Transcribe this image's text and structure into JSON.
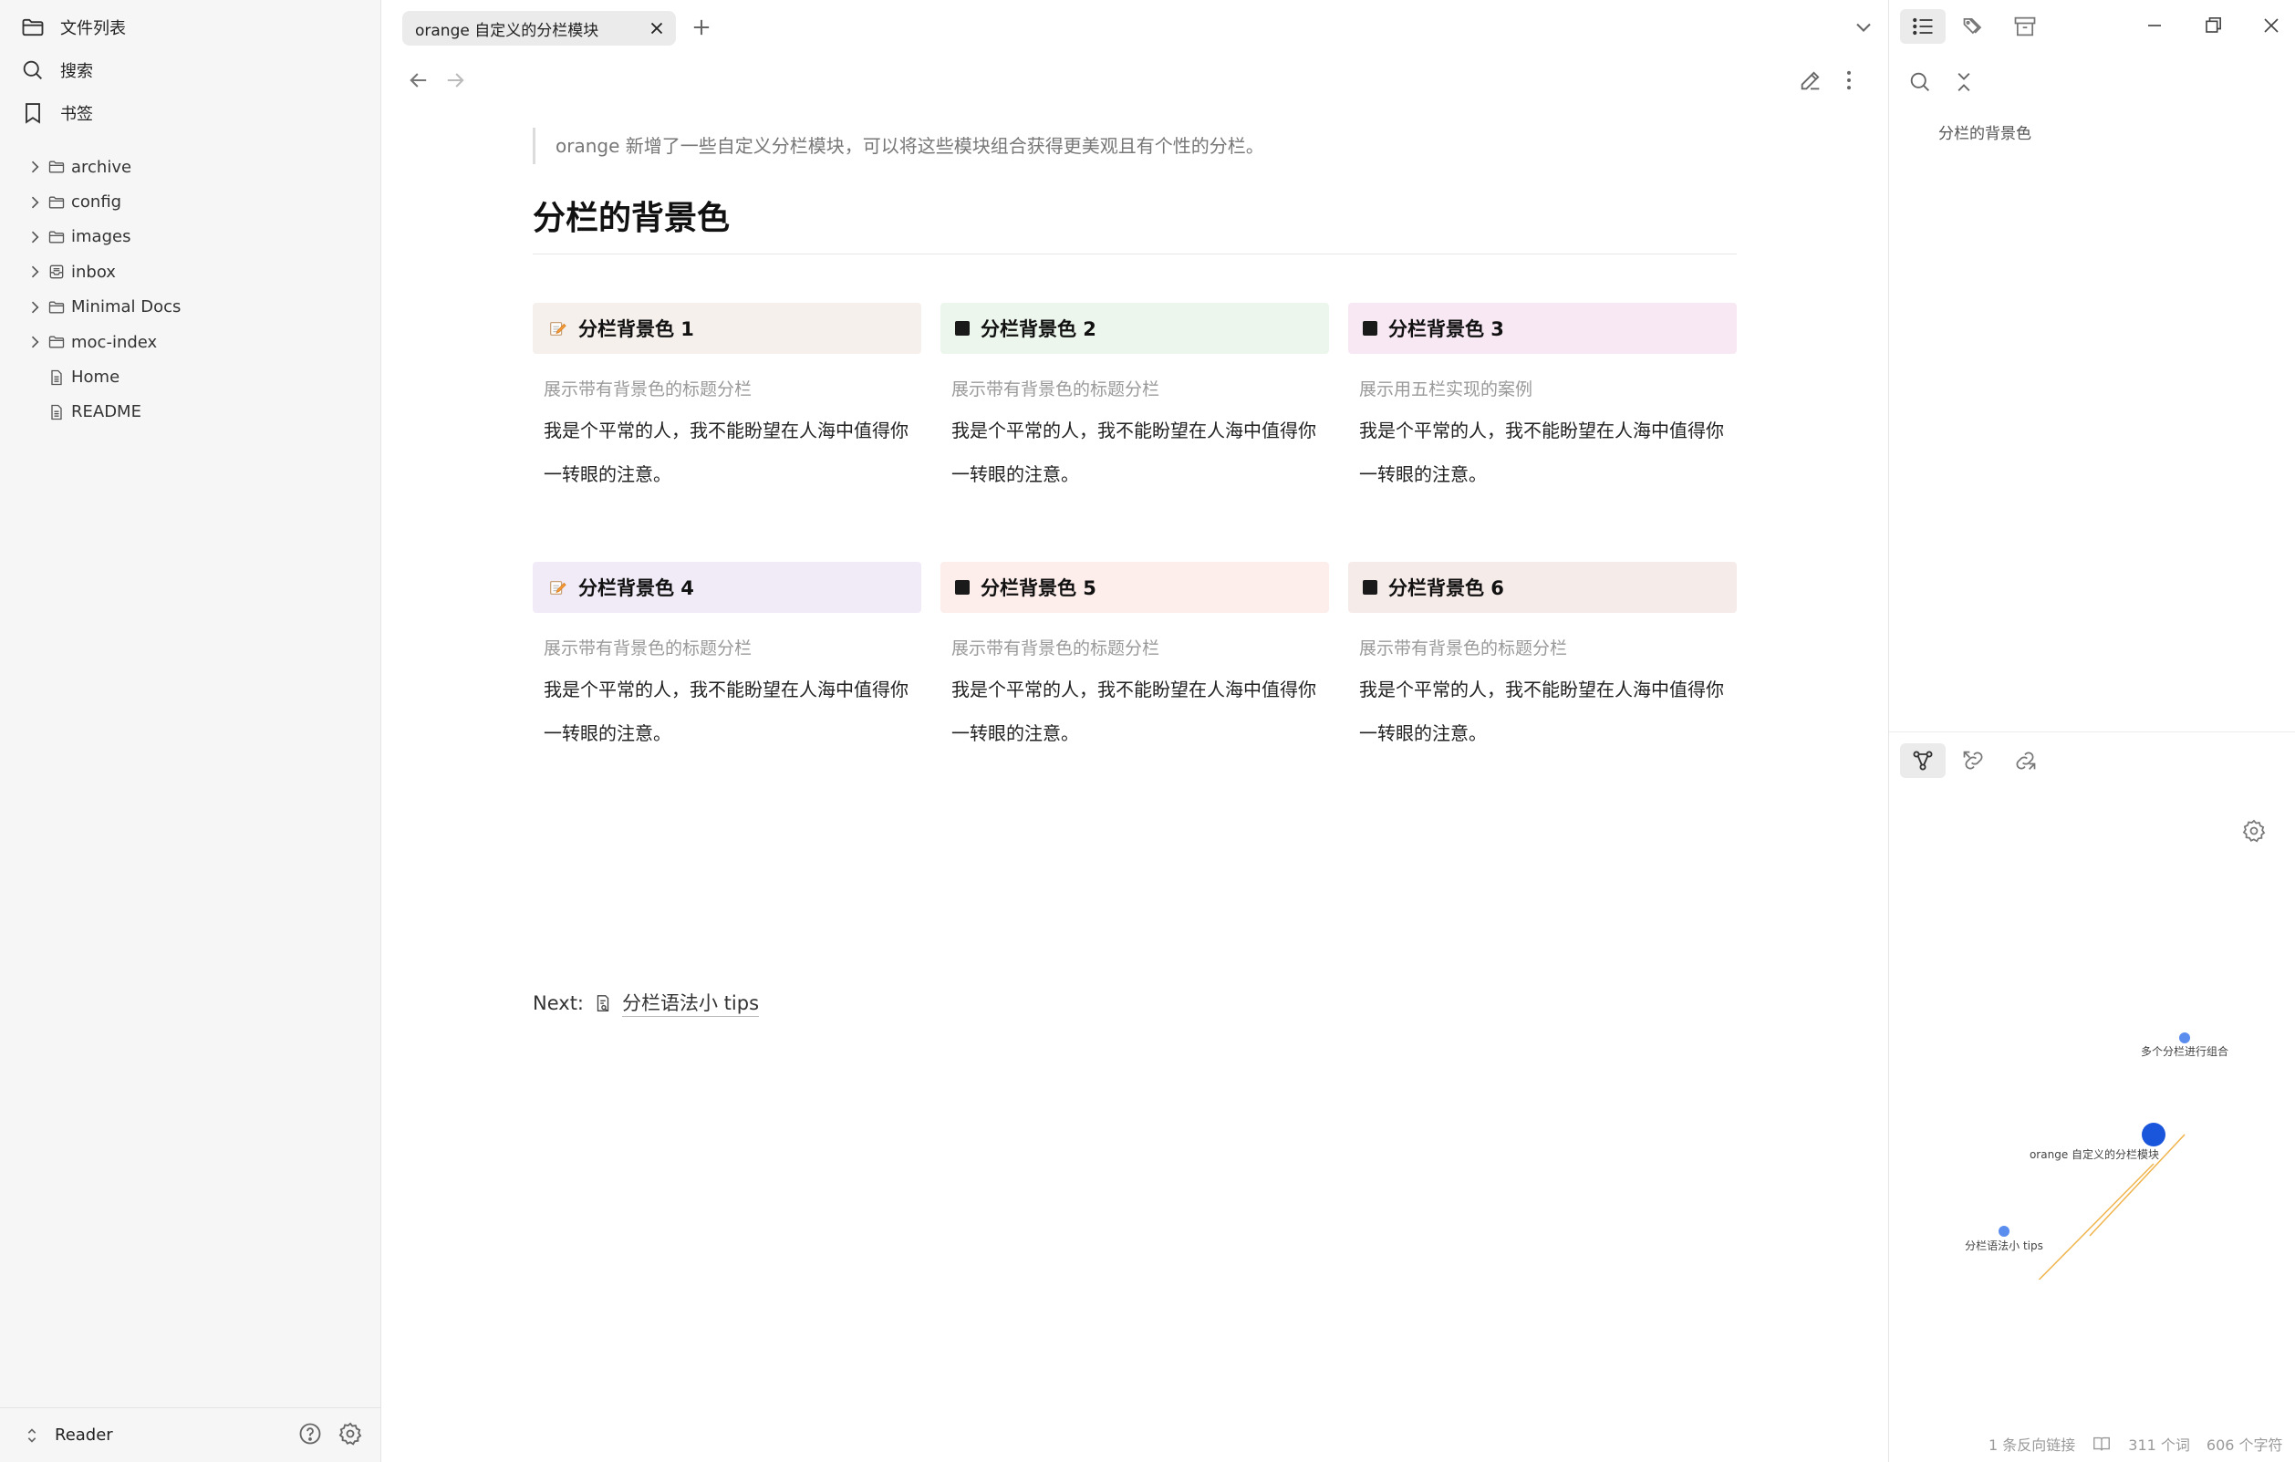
{
  "sidebar": {
    "nav": {
      "files_label": "文件列表",
      "search_label": "搜索",
      "bookmarks_label": "书签"
    },
    "tree": [
      {
        "label": "archive",
        "kind": "folder",
        "expandable": true
      },
      {
        "label": "config",
        "kind": "folder",
        "expandable": true
      },
      {
        "label": "images",
        "kind": "folder",
        "expandable": true
      },
      {
        "label": "inbox",
        "kind": "inbox",
        "expandable": true
      },
      {
        "label": "Minimal Docs",
        "kind": "folder",
        "expandable": true
      },
      {
        "label": "moc-index",
        "kind": "folder",
        "expandable": true
      },
      {
        "label": "Home",
        "kind": "file",
        "expandable": false
      },
      {
        "label": "README",
        "kind": "file",
        "expandable": false
      }
    ],
    "footer": {
      "vault_name": "Reader"
    }
  },
  "tabs": {
    "active_title": "orange 自定义的分栏模块"
  },
  "note": {
    "quote": "orange 新增了一些自定义分栏模块，可以将这些模块组合获得更美观且有个性的分栏。",
    "heading": "分栏的背景色",
    "cards": [
      {
        "title": "分栏背景色 1",
        "icon": "pencil",
        "bg": "#f5f0eb",
        "sub": "展示带有背景色的标题分栏",
        "body": "我是个平常的人，我不能盼望在人海中值得你一转眼的注意。"
      },
      {
        "title": "分栏背景色 2",
        "icon": "square",
        "bg": "#edf6ed",
        "sub": "展示带有背景色的标题分栏",
        "body": "我是个平常的人，我不能盼望在人海中值得你一转眼的注意。"
      },
      {
        "title": "分栏背景色 3",
        "icon": "square",
        "bg": "#f7e8f4",
        "sub": "展示用五栏实现的案例",
        "body": "我是个平常的人，我不能盼望在人海中值得你一转眼的注意。"
      },
      {
        "title": "分栏背景色 4",
        "icon": "pencil",
        "bg": "#f1ebf7",
        "sub": "展示带有背景色的标题分栏",
        "body": "我是个平常的人，我不能盼望在人海中值得你一转眼的注意。"
      },
      {
        "title": "分栏背景色 5",
        "icon": "square",
        "bg": "#fdeeec",
        "sub": "展示带有背景色的标题分栏",
        "body": "我是个平常的人，我不能盼望在人海中值得你一转眼的注意。"
      },
      {
        "title": "分栏背景色 6",
        "icon": "square",
        "bg": "#f5ebe8",
        "sub": "展示带有背景色的标题分栏",
        "body": "我是个平常的人，我不能盼望在人海中值得你一转眼的注意。"
      }
    ],
    "next_label": "Next:",
    "next_link": "分栏语法小 tips"
  },
  "right_panel": {
    "outline_item": "分栏的背景色",
    "graph": {
      "nodes": [
        {
          "label": "多个分栏进行组合",
          "role": "linked"
        },
        {
          "label": "orange 自定义的分栏模块",
          "role": "current"
        },
        {
          "label": "分栏语法小 tips",
          "role": "linked"
        }
      ],
      "colors": {
        "current": "#1a56db",
        "linked": "#5b8def",
        "edge": "#f0b44c"
      }
    }
  },
  "status": {
    "backlinks": "1 条反向链接",
    "words": "311 个词",
    "chars": "606 个字符"
  }
}
